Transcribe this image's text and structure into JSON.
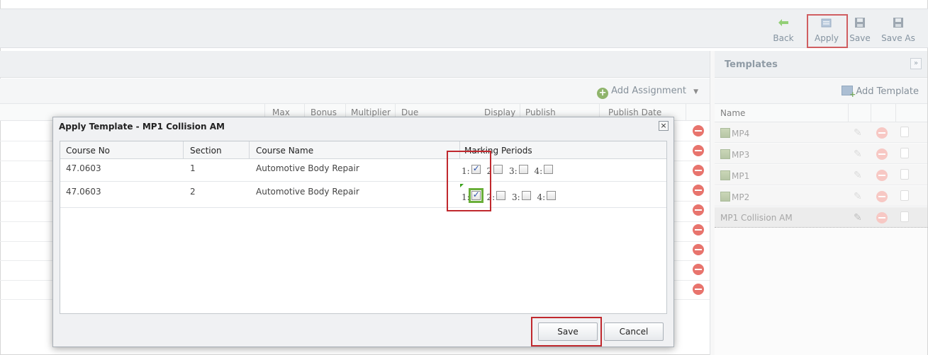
{
  "toolbar": {
    "back_label": "Back",
    "apply_label": "Apply",
    "save_label": "Save",
    "save_as_label": "Save As"
  },
  "assignments": {
    "add_label": "Add Assignment",
    "columns": [
      "Max",
      "Bonus",
      "Multiplier",
      "Due",
      "Display",
      "Publish",
      "Publish Date"
    ]
  },
  "templates": {
    "title": "Templates",
    "add_label": "Add Template",
    "name_header": "Name",
    "items": [
      "MP4",
      "MP3",
      "MP1",
      "MP2",
      "MP1 Collision AM"
    ]
  },
  "modal": {
    "title": "Apply Template - MP1 Collision AM",
    "columns": {
      "course_no": "Course No",
      "section": "Section",
      "course_name": "Course Name",
      "marking_periods": "Marking Periods"
    },
    "rows": [
      {
        "course_no": "47.0603",
        "section": "1",
        "course_name": "Automotive Body Repair",
        "periods": [
          "1:",
          "2",
          "3:",
          "4:"
        ],
        "checked": [
          true,
          false,
          false,
          false
        ]
      },
      {
        "course_no": "47.0603",
        "section": "2",
        "course_name": "Automotive Body Repair",
        "periods": [
          "1:",
          "2:",
          "3:",
          "4:"
        ],
        "checked": [
          true,
          false,
          false,
          false
        ]
      }
    ],
    "save_label": "Save",
    "cancel_label": "Cancel"
  },
  "colors": {
    "highlight": "#c0282d",
    "focus": "#6aaf3a",
    "delete": "#e0463d"
  }
}
